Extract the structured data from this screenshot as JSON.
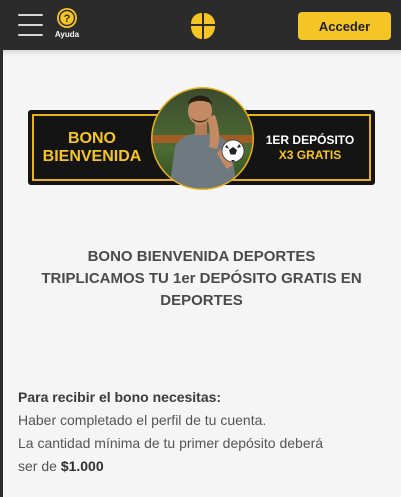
{
  "header": {
    "help_label": "Ayuda",
    "help_icon_char": "?",
    "login_label": "Acceder",
    "accent_color": "#f5c526",
    "bar_color": "#2b2b2b"
  },
  "banner": {
    "left_line1": "BONO",
    "left_line2": "BIENVENIDA",
    "right_line1": "1ER DEPÓSITO",
    "right_line2": "X3 GRATIS"
  },
  "promo": {
    "title_line1": "BONO BIENVENIDA DEPORTES",
    "title_line2": "TRIPLICAMOS TU 1er DEPÓSITO GRATIS EN",
    "title_line3": "DEPORTES"
  },
  "requirements": {
    "heading": "Para recibir el bono necesitas:",
    "line1": "Haber completado el perfil de tu cuenta.",
    "line2": "La cantidad mínima de tu primer depósito deberá",
    "line3_prefix": "ser de ",
    "line3_amount": "$1.000"
  }
}
